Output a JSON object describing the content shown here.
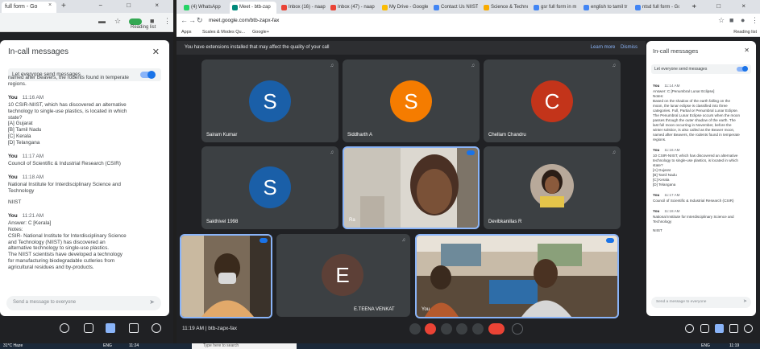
{
  "left_browser": {
    "tab_title": "full form - Go",
    "tab_close": "×",
    "new_tab": "+",
    "window_controls": "− □ ×",
    "reading_list": "Reading list"
  },
  "chat_left": {
    "title": "In-call messages",
    "toggle_label": "Let everyone send messages",
    "messages": [
      {
        "sender": "",
        "time": "",
        "lines": [
          "named after Beavers, the rodents found in temperate",
          "regions."
        ]
      },
      {
        "sender": "You",
        "time": "11:16 AM",
        "lines": [
          "10 CSIR-NIIST, which has discovered an alternative",
          "technology to single-use plastics, is located in which",
          "state?",
          "[A] Gujarat",
          "[B] Tamil Nadu",
          "[C] Kerala",
          "[D] Telangana"
        ]
      },
      {
        "sender": "You",
        "time": "11:17 AM",
        "lines": [
          "Council of Scientific & Industrial Research (CSIR)"
        ]
      },
      {
        "sender": "You",
        "time": "11:18 AM",
        "lines": [
          "National Institute for Interdisciplinary Science and",
          "Technology",
          "",
          "NIIST"
        ]
      },
      {
        "sender": "You",
        "time": "11:21 AM",
        "lines": [
          "Answer: C [Kerala]",
          "Notes:",
          "CSIR- National Institute for Interdisciplinary Science",
          "and Technology (NIIST) has discovered an",
          "alternative technology to single-use plastics.",
          "The NIIST scientists have developed a technology",
          "for manufacturing biodegradable cutleries from",
          "agricultural residues and by-products."
        ]
      }
    ],
    "input_placeholder": "Send a message to everyone"
  },
  "right_browser": {
    "tabs": [
      {
        "label": "(4) WhatsApp",
        "color": "#25d366"
      },
      {
        "label": "Meet - btb-zap",
        "color": "#00897b"
      },
      {
        "label": "Inbox (16) - naap",
        "color": "#ea4335"
      },
      {
        "label": "Inbox (47) - naap",
        "color": "#ea4335"
      },
      {
        "label": "My Drive - Google",
        "color": "#fbbc04"
      },
      {
        "label": "Contact Us NIIST",
        "color": "#4285f4"
      },
      {
        "label": "Science & Technolo",
        "color": "#f9ab00"
      },
      {
        "label": "gsr full form in m",
        "color": "#4285f4"
      },
      {
        "label": "english to tamil tr",
        "color": "#4285f4"
      },
      {
        "label": "ntsd full form - Go",
        "color": "#4285f4"
      }
    ],
    "new_tab": "+",
    "window_controls": "− □ ×",
    "url": "meet.google.com/btb-zapx-fax",
    "bookmarks": [
      "Apps",
      "Scales & Modes Qu...",
      "Google+"
    ],
    "reading_list": "Reading list"
  },
  "extension_banner": {
    "text": "You have extensions installed that may affect the quality of your call",
    "learn_more": "Learn more",
    "dismiss": "Dismiss"
  },
  "participants": [
    {
      "name": "Sairam Kumar",
      "initial": "S",
      "color": "#1a5fa8"
    },
    {
      "name": "Siddharth A",
      "initial": "S",
      "color": "#f57c00"
    },
    {
      "name": "Chellam Chandru",
      "initial": "C",
      "color": "#c3341a"
    },
    {
      "name": "Sakthivel 1998",
      "initial": "S",
      "color": "#1a5fa8"
    },
    {
      "name": "Ra",
      "initial": "",
      "color": ""
    },
    {
      "name": "Devibkanillas R",
      "initial": "",
      "color": ""
    },
    {
      "name": "",
      "initial": "",
      "color": ""
    },
    {
      "name": "E.TEENA VENKAT",
      "initial": "E",
      "color": "#5d4037"
    },
    {
      "name": "You",
      "initial": "",
      "color": ""
    }
  ],
  "chat_right": {
    "title": "In-call messages",
    "toggle_label": "Let everyone send messages",
    "messages": [
      {
        "sender": "You",
        "time": "11:14 AM",
        "lines": [
          "Answer: C [Penumbral Lunar Eclipse]",
          "Notes:",
          "Based on the shadow of the earth falling on the",
          "moon, the lunar eclipse is classified into three",
          "categories. Full, Partial or Penumbral Lunar Eclipse.",
          "The Penumbral Lunar Eclipse occurs when the moon",
          "passes through the outer shadow of the earth. The",
          "last full moon occurring in November, before the",
          "winter solstice, is also called as the Beaver moon,",
          "named after Beavers, the rodents found in temperate",
          "regions."
        ]
      },
      {
        "sender": "You",
        "time": "11:16 AM",
        "lines": [
          "10 CSIR-NIIST, which has discovered an alternative",
          "technology to single-use plastics, is located in which",
          "state?",
          "[A] Gujarat",
          "[B] Tamil Nadu",
          "[C] Kerala",
          "[D] Telangana"
        ]
      },
      {
        "sender": "You",
        "time": "11:17 AM",
        "lines": [
          "Council of Scientific & Industrial Research (CSIR)"
        ]
      },
      {
        "sender": "You",
        "time": "11:18 AM",
        "lines": [
          "National Institute for Interdisciplinary Science and",
          "Technology",
          "",
          "NIIST"
        ]
      }
    ],
    "input_placeholder": "Send a message to everyone"
  },
  "meeting_bar": {
    "time_code": "11:19 AM  |  btb-zapx-fax"
  },
  "taskbar": {
    "weather": "31°C Haze",
    "lang": "ENG",
    "left_clock": "11:24",
    "search_placeholder": "Type here to search",
    "right_clock": "11:19"
  }
}
